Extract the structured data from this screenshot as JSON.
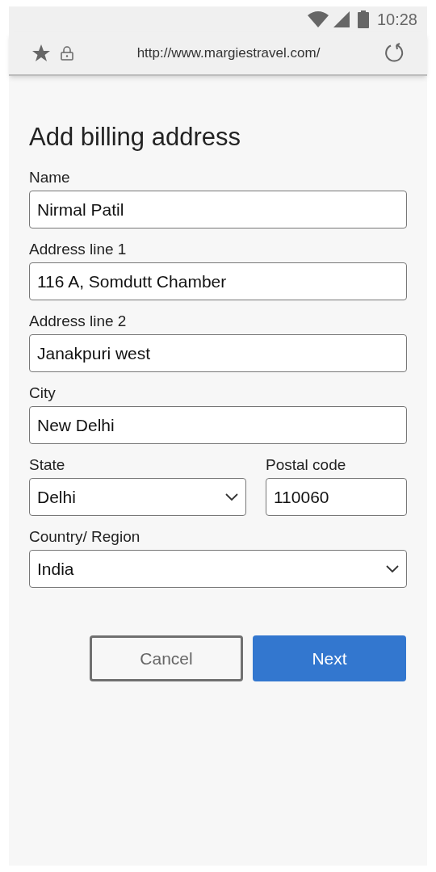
{
  "status_bar": {
    "time": "10:28"
  },
  "browser": {
    "url": "http://www.margiestravel.com/"
  },
  "title": "Add billing address",
  "form_rows": [
    [
      {
        "label": "Name",
        "value": "Nirmal Patil",
        "kind": "text"
      }
    ],
    [
      {
        "label": "Address line 1",
        "value": "116 A, Somdutt Chamber",
        "kind": "text"
      }
    ],
    [
      {
        "label": "Address line 2",
        "value": "Janakpuri west",
        "kind": "text"
      }
    ],
    [
      {
        "label": "City",
        "value": "New Delhi",
        "kind": "text"
      }
    ],
    [
      {
        "label": "State",
        "value": "Delhi",
        "kind": "select"
      },
      {
        "label": "Postal code",
        "value": "110060",
        "kind": "text"
      }
    ],
    [
      {
        "label": "Country/ Region",
        "value": "India",
        "kind": "select"
      }
    ]
  ],
  "buttons": [
    {
      "label": "Cancel",
      "kind": "secondary"
    },
    {
      "label": "Next",
      "kind": "primary"
    }
  ]
}
